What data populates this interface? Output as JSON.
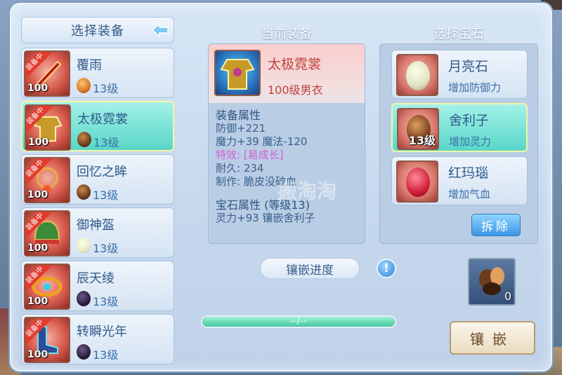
{
  "left": {
    "title": "选择装备",
    "items": [
      {
        "name": "覆雨",
        "badge": "装备中",
        "level": "100",
        "gem_level": "13级",
        "gem_color": "#d9782a"
      },
      {
        "name": "太极霓裳",
        "badge": "装备中",
        "level": "100",
        "gem_level": "13级",
        "gem_color": "#6e3b1e",
        "selected": true
      },
      {
        "name": "回忆之眸",
        "badge": "装备中",
        "level": "100",
        "gem_level": "13级",
        "gem_color": "#6e3b1e"
      },
      {
        "name": "御神盔",
        "badge": "装备中",
        "level": "100",
        "gem_level": "13级",
        "gem_color": "#e7ebc7"
      },
      {
        "name": "辰天绫",
        "badge": "装备中",
        "level": "100",
        "gem_level": "13级",
        "gem_color": "#2c1c3c"
      },
      {
        "name": "转瞬光年",
        "badge": "装备中",
        "level": "100",
        "gem_level": "13级",
        "gem_color": "#2c1c3c"
      }
    ]
  },
  "center": {
    "title": "当前装备",
    "equip_name": "太极霓裳",
    "equip_sub": "100级男衣",
    "attr_label": "装备属性",
    "attr_lines": [
      "防御+221",
      "魔力+39 魔法-120"
    ],
    "special": "特效: [易成长]",
    "durability": "耐久: 234",
    "maker": "制作: 脆皮没破血",
    "gem_attr_label": "宝石属性 (等级13)",
    "gem_attr_line": "灵力+93 镶嵌舍利子",
    "watermark": "搬淘淘",
    "progress_label": "镶嵌进度",
    "progress_text": "--/--",
    "info_icon": "!",
    "progress_value": 1.0
  },
  "right": {
    "title": "选择宝石",
    "gems": [
      {
        "name": "月亮石",
        "desc": "增加防御力",
        "color": "#dfe3c2"
      },
      {
        "name": "舍利子",
        "desc": "增加灵力",
        "level": "13级",
        "color": "#7a3f1e",
        "selected": true
      },
      {
        "name": "红玛瑙",
        "desc": "增加气血",
        "color": "#d1203a"
      }
    ],
    "remove_label": "拆除",
    "slot_count": "0",
    "inlay_label": "镶嵌"
  }
}
